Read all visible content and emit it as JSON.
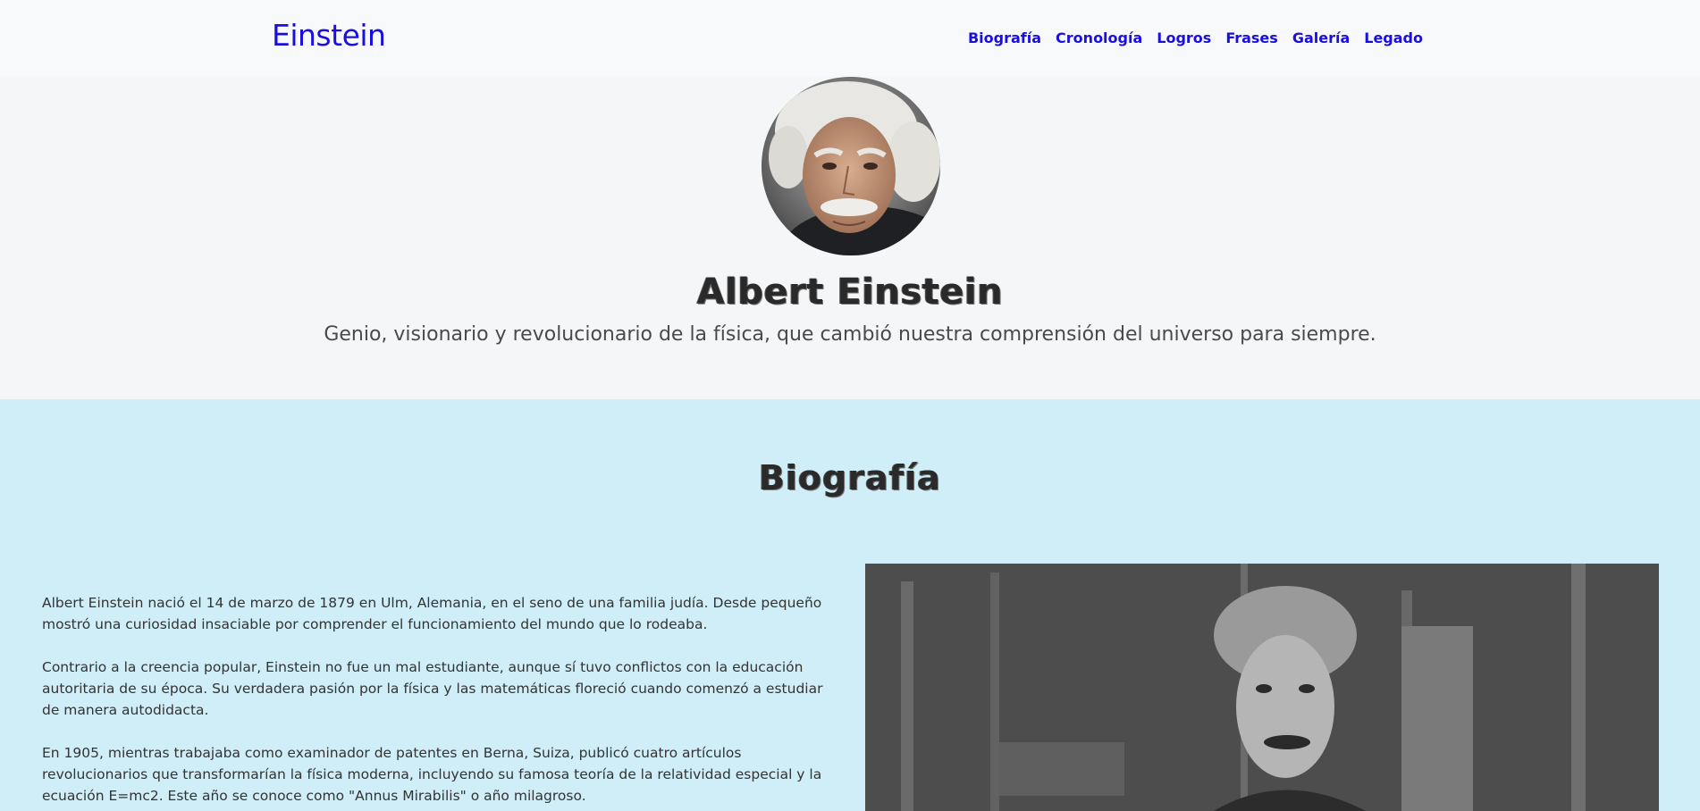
{
  "header": {
    "brand": "Einstein",
    "nav": [
      "Biografía",
      "Cronología",
      "Logros",
      "Frases",
      "Galería",
      "Legado"
    ]
  },
  "hero": {
    "title": "Albert Einstein",
    "subtitle": "Genio, visionario y revolucionario de la física, que cambió nuestra comprensión del universo para siempre."
  },
  "biography": {
    "title": "Biografía",
    "paragraphs": [
      "Albert Einstein nació el 14 de marzo de 1879 en Ulm, Alemania, en el seno de una familia judía. Desde pequeño mostró una curiosidad insaciable por comprender el funcionamiento del mundo que lo rodeaba.",
      "Contrario a la creencia popular, Einstein no fue un mal estudiante, aunque sí tuvo conflictos con la educación autoritaria de su época. Su verdadera pasión por la física y las matemáticas floreció cuando comenzó a estudiar de manera autodidacta.",
      "En 1905, mientras trabajaba como examinador de patentes en Berna, Suiza, publicó cuatro artículos revolucionarios que transformarían la física moderna, incluyendo su famosa teoría de la relatividad especial y la ecuación E=mc2. Este año se conoce como \"Annus Mirabilis\" o año milagroso."
    ]
  },
  "colors": {
    "brand": "#1a0fe0",
    "hero_bg": "#f5f6f8",
    "bio_bg": "#cfeef7"
  }
}
